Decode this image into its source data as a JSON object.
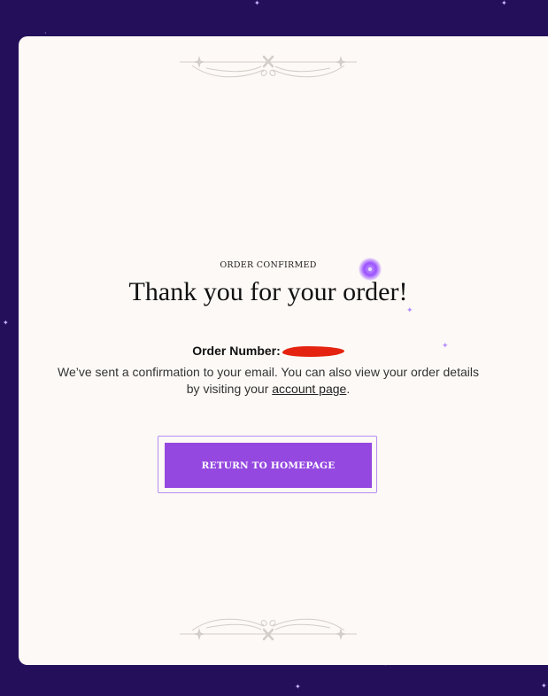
{
  "colors": {
    "page_background": "#24105a",
    "card_background": "#fdf9f6",
    "accent": "#9448e0",
    "redaction": "#e42410"
  },
  "confirmation": {
    "eyebrow": "ORDER CONFIRMED",
    "title": "Thank you for your order!",
    "order_number_label": "Order Number:",
    "order_number_value": "",
    "message_before_link": "We’ve sent a confirmation to your email. You can also view your order details by visiting your ",
    "account_link_label": "account page",
    "message_after_link": "."
  },
  "actions": {
    "return_home_label": "RETURN TO HOMEPAGE"
  },
  "decorations": {
    "top_flourish_icon": "ornamental-flourish-icon",
    "bottom_flourish_icon": "ornamental-flourish-icon",
    "sparkle_icon": "sparkle-icon"
  }
}
